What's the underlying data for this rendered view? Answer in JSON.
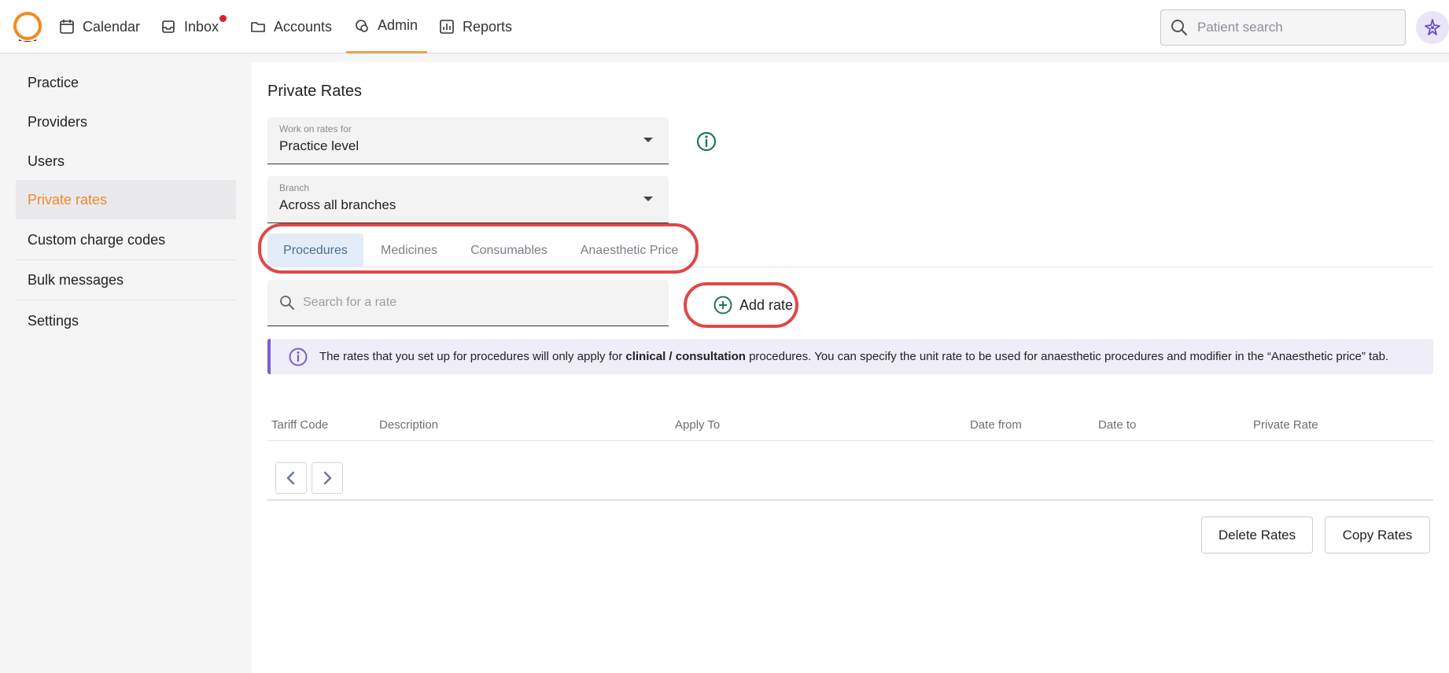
{
  "nav": {
    "items": [
      {
        "label": "Calendar",
        "icon": "calendar-icon"
      },
      {
        "label": "Inbox",
        "icon": "inbox-icon"
      },
      {
        "label": "Accounts",
        "icon": "folder-icon"
      },
      {
        "label": "Admin",
        "icon": "admin-icon"
      },
      {
        "label": "Reports",
        "icon": "reports-icon"
      }
    ],
    "active": "Admin",
    "search_placeholder": "Patient search",
    "accent_color": "#f0a04b"
  },
  "sidebar": {
    "items": [
      {
        "label": "Practice"
      },
      {
        "label": "Providers"
      },
      {
        "label": "Users"
      },
      {
        "label": "Private rates"
      },
      {
        "label": "Custom charge codes"
      },
      {
        "label": "Bulk messages"
      },
      {
        "label": "Settings"
      }
    ],
    "active": "Private rates"
  },
  "main": {
    "title": "Private Rates",
    "work_on": {
      "label": "Work on rates for",
      "value": "Practice level"
    },
    "branch": {
      "label": "Branch",
      "value": "Across all branches"
    },
    "tabs": [
      {
        "label": "Procedures"
      },
      {
        "label": "Medicines"
      },
      {
        "label": "Consumables"
      },
      {
        "label": "Anaesthetic Price"
      }
    ],
    "active_tab": "Procedures",
    "search_placeholder": "Search for a rate",
    "add_rate_label": "Add rate",
    "banner": {
      "part1": "The rates that you set up for procedures will only apply for ",
      "bold1": "clinical",
      "sep": " / ",
      "bold2": "consultation",
      "part2": " procedures. You can specify the unit rate to be used for anaesthetic procedures and modifier in the “Anaesthetic price” tab."
    },
    "table": {
      "columns": [
        "Tariff Code",
        "Description",
        "Apply To",
        "Date from",
        "Date to",
        "Private Rate"
      ],
      "rows": []
    },
    "delete_label": "Delete Rates",
    "copy_label": "Copy Rates"
  }
}
